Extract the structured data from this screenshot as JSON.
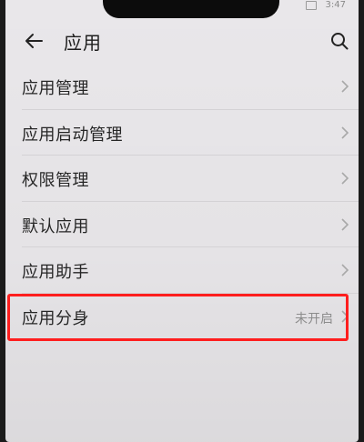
{
  "status_bar": {
    "time": "3:47"
  },
  "header": {
    "title": "应用",
    "back_icon": "back-arrow-icon",
    "search_icon": "search-icon"
  },
  "menu": {
    "items": [
      {
        "label": "应用管理"
      },
      {
        "label": "应用启动管理"
      },
      {
        "label": "权限管理"
      },
      {
        "label": "默认应用"
      },
      {
        "label": "应用助手"
      },
      {
        "label": "应用分身",
        "value": "未开启"
      }
    ]
  },
  "annotation": {
    "highlight_color": "#ff1e1e"
  }
}
